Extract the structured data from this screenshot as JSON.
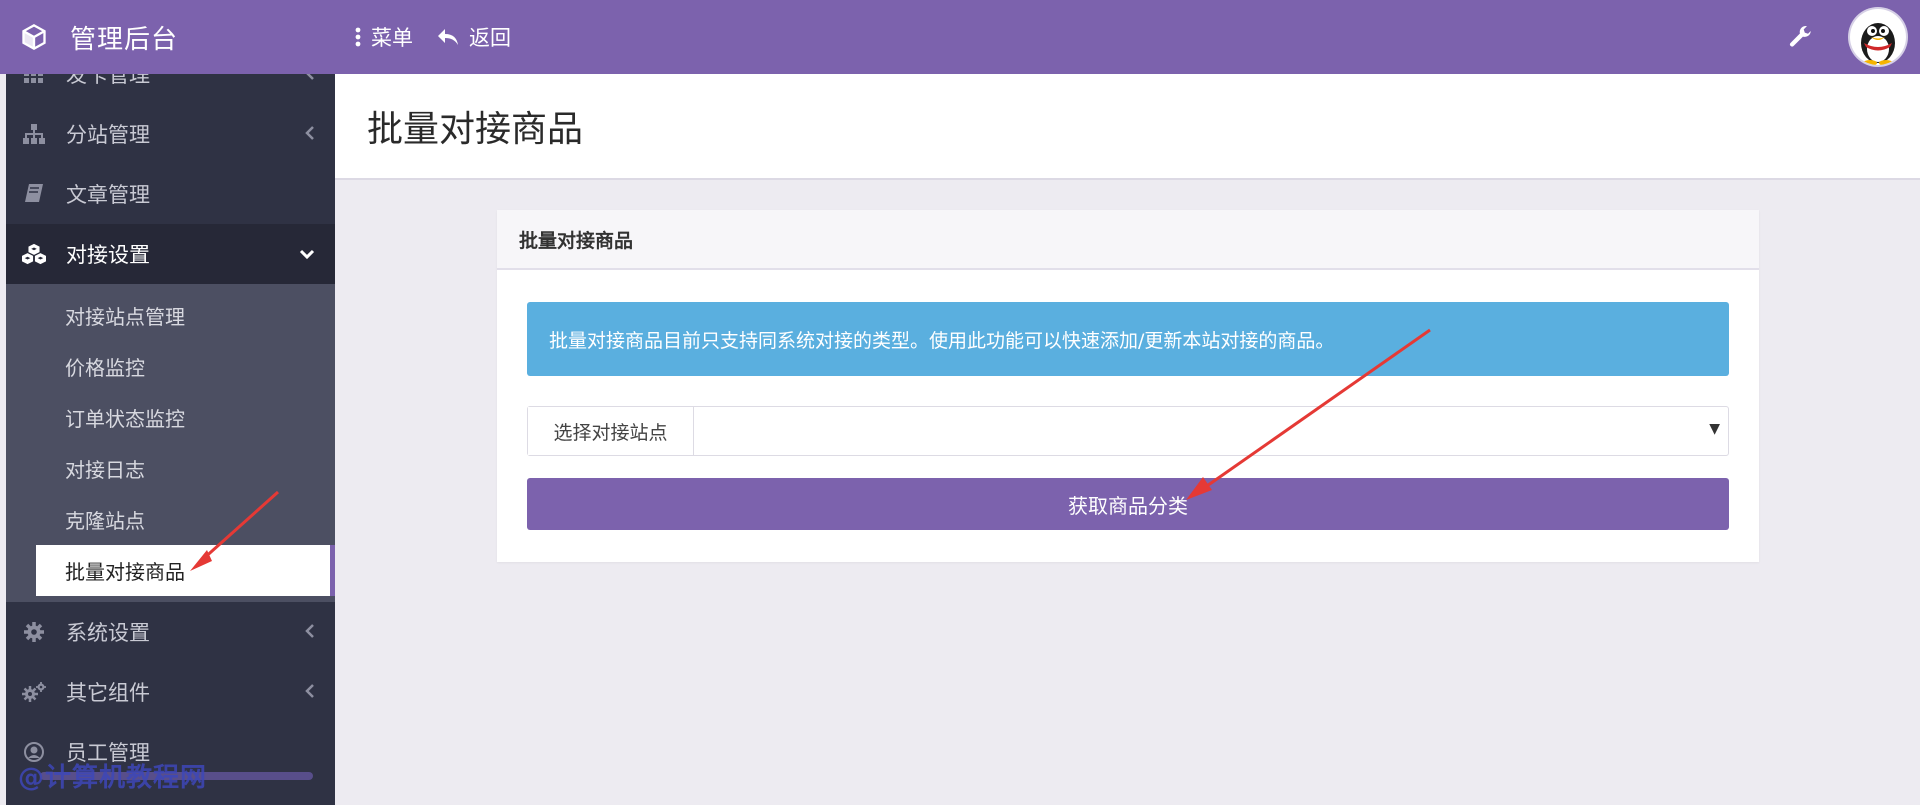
{
  "app": {
    "title": "管理后台"
  },
  "topnav": {
    "menu_label": "菜单",
    "back_label": "返回"
  },
  "sidebar": {
    "items_top": [
      {
        "label": "发卡管理",
        "icon": "grid-icon"
      },
      {
        "label": "分站管理",
        "icon": "sitemap-icon"
      },
      {
        "label": "文章管理",
        "icon": "book-icon"
      }
    ],
    "open_item": {
      "label": "对接设置",
      "icon": "cubes-icon"
    },
    "submenu": [
      "对接站点管理",
      "价格监控",
      "订单状态监控",
      "对接日志",
      "克隆站点",
      "批量对接商品"
    ],
    "items_bottom": [
      {
        "label": "系统设置",
        "icon": "gear-icon"
      },
      {
        "label": "其它组件",
        "icon": "gears-icon"
      },
      {
        "label": "员工管理",
        "icon": "user-icon"
      }
    ]
  },
  "watermark": "@计算机教程网",
  "page": {
    "title": "批量对接商品"
  },
  "card": {
    "title": "批量对接商品",
    "alert": "批量对接商品目前只支持同系统对接的类型。使用此功能可以快速添加/更新本站对接的商品。",
    "select_label": "选择对接站点",
    "select_value": "",
    "button_label": "获取商品分类"
  },
  "colors": {
    "brand": "#7c62ad",
    "sidebar": "#2f3244",
    "alert": "#5aafdf",
    "annotation": "#e53935"
  }
}
